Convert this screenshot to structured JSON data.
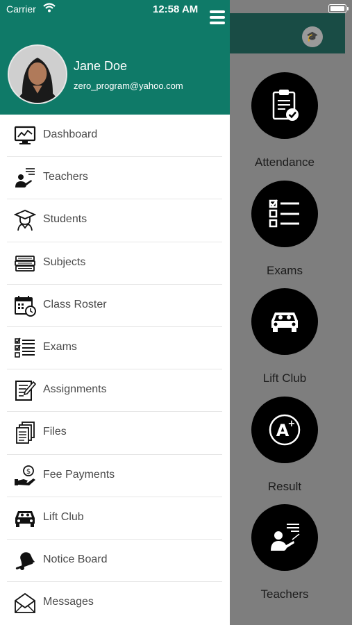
{
  "status_bar": {
    "carrier": "Carrier",
    "time": "12:58 AM"
  },
  "user": {
    "name": "Jane Doe",
    "email": "zero_program@yahoo.com"
  },
  "menu": {
    "items": [
      {
        "label": "Dashboard",
        "icon": "dashboard-icon"
      },
      {
        "label": "Teachers",
        "icon": "teacher-icon"
      },
      {
        "label": "Students",
        "icon": "student-icon"
      },
      {
        "label": "Subjects",
        "icon": "books-icon"
      },
      {
        "label": "Class Roster",
        "icon": "calendar-clock-icon"
      },
      {
        "label": "Exams",
        "icon": "checklist-icon"
      },
      {
        "label": "Assignments",
        "icon": "assignment-icon"
      },
      {
        "label": "Files",
        "icon": "files-icon"
      },
      {
        "label": "Fee Payments",
        "icon": "payment-icon"
      },
      {
        "label": "Lift Club",
        "icon": "car-icon"
      },
      {
        "label": "Notice Board",
        "icon": "bell-icon"
      },
      {
        "label": "Messages",
        "icon": "envelope-icon"
      }
    ]
  },
  "background": {
    "tiles": [
      {
        "label": "Attendance",
        "icon": "clipboard-check-icon"
      },
      {
        "label": "Exams",
        "icon": "checklist-icon"
      },
      {
        "label": "Lift Club",
        "icon": "car-icon"
      },
      {
        "label": "Result",
        "icon": "grade-icon"
      },
      {
        "label": "Teachers",
        "icon": "teacher-icon"
      }
    ]
  },
  "colors": {
    "drawer_header": "#0f7a68",
    "app_header": "#194c45",
    "overlay": "#7e7e7e"
  }
}
